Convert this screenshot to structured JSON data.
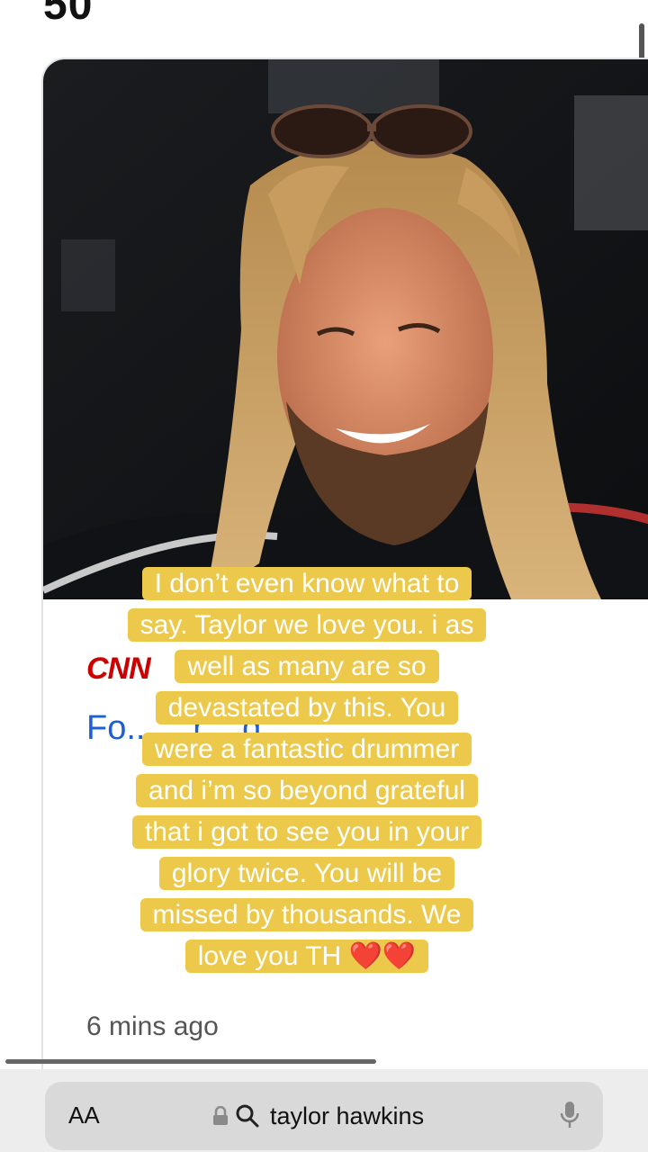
{
  "page": {
    "top_number": "50"
  },
  "article": {
    "source": "CNN",
    "headline": "Fo... ...r ...d, ...",
    "timestamp": "6 mins ago"
  },
  "overlay": {
    "caption_lines": [
      "I don’t even know what to",
      "say. Taylor we love you. i as",
      "well as many are so",
      "devastated by this. You",
      "were a fantastic drummer",
      "and i’m so beyond grateful",
      "that i got to see you in your",
      "glory twice. You will be",
      "missed by thousands. We",
      "love you TH ❤️❤️"
    ]
  },
  "browser": {
    "text_size_label": "AA",
    "url_text": "taylor hawkins",
    "icons": [
      "text-size-icon",
      "lock-icon",
      "search-icon",
      "microphone-icon"
    ]
  },
  "colors": {
    "caption_bg": "#ecc94b",
    "link": "#1f5fd6",
    "source_red": "#cc0000"
  }
}
